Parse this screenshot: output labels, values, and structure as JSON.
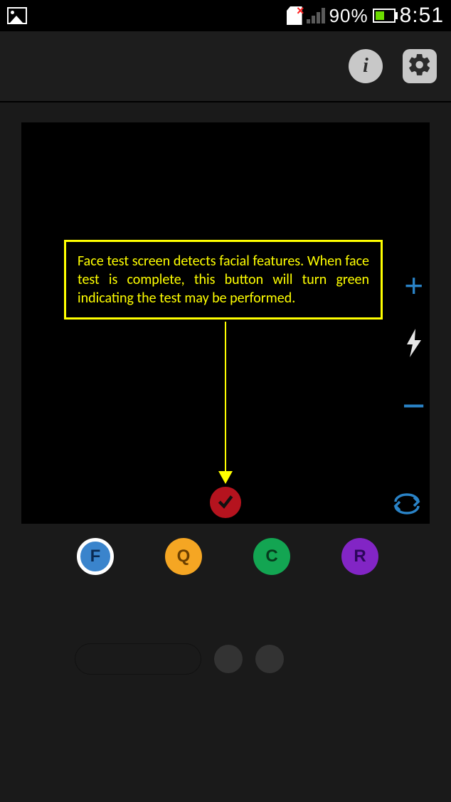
{
  "status": {
    "battery": "90%",
    "time": "8:51"
  },
  "callout": {
    "text": "Face test screen detects facial features. When face test is complete, this button will turn green indicating the test may be performed."
  },
  "modes": {
    "f": "F",
    "q": "Q",
    "c": "C",
    "r": "R"
  },
  "icons": {
    "plus": "+",
    "minus": "−"
  },
  "info_label": "i"
}
